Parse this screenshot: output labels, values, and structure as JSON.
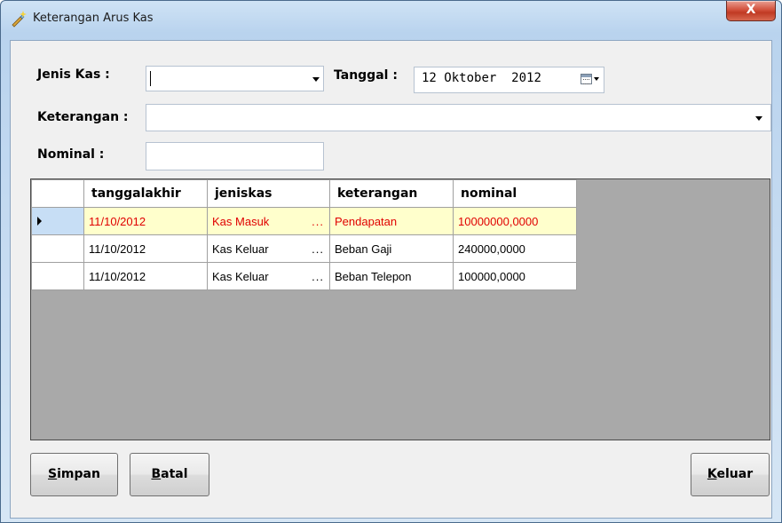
{
  "window": {
    "title": "Keterangan Arus Kas",
    "close_glyph": "X"
  },
  "form": {
    "jenis_kas_label": "Jenis Kas :",
    "jenis_kas_value": "",
    "tanggal_label": "Tanggal :",
    "tanggal_day": "12",
    "tanggal_month": "Oktober",
    "tanggal_year": "2012",
    "keterangan_label": "Keterangan :",
    "keterangan_value": "",
    "nominal_label": "Nominal :",
    "nominal_value": ""
  },
  "grid": {
    "columns": [
      "tanggalakhir",
      "jeniskas",
      "keterangan",
      "nominal"
    ],
    "rows": [
      {
        "tanggalakhir": "11/10/2012",
        "jeniskas": "Kas Masuk",
        "ellipsis": "...",
        "keterangan": "Pendapatan",
        "nominal": "10000000,0000",
        "selected": true
      },
      {
        "tanggalakhir": "11/10/2012",
        "jeniskas": "Kas Keluar",
        "ellipsis": "...",
        "keterangan": "Beban Gaji",
        "nominal": "240000,0000",
        "selected": false
      },
      {
        "tanggalakhir": "11/10/2012",
        "jeniskas": "Kas Keluar",
        "ellipsis": "...",
        "keterangan": "Beban Telepon",
        "nominal": "100000,0000",
        "selected": false
      }
    ]
  },
  "buttons": {
    "simpan_mnemonic": "S",
    "simpan_rest": "impan",
    "batal_mnemonic": "B",
    "batal_rest": "atal",
    "keluar_mnemonic": "K",
    "keluar_rest": "eluar"
  },
  "colors": {
    "selected_row_text": "#e00000",
    "selected_row_bg": "#ffffcc",
    "grid_background": "#a9a9a9"
  },
  "icons": {
    "title": "pencil-sparkle-icon",
    "dropdown": "chevron-down-icon",
    "calendar": "calendar-icon",
    "row_pointer": "row-pointer-icon"
  }
}
